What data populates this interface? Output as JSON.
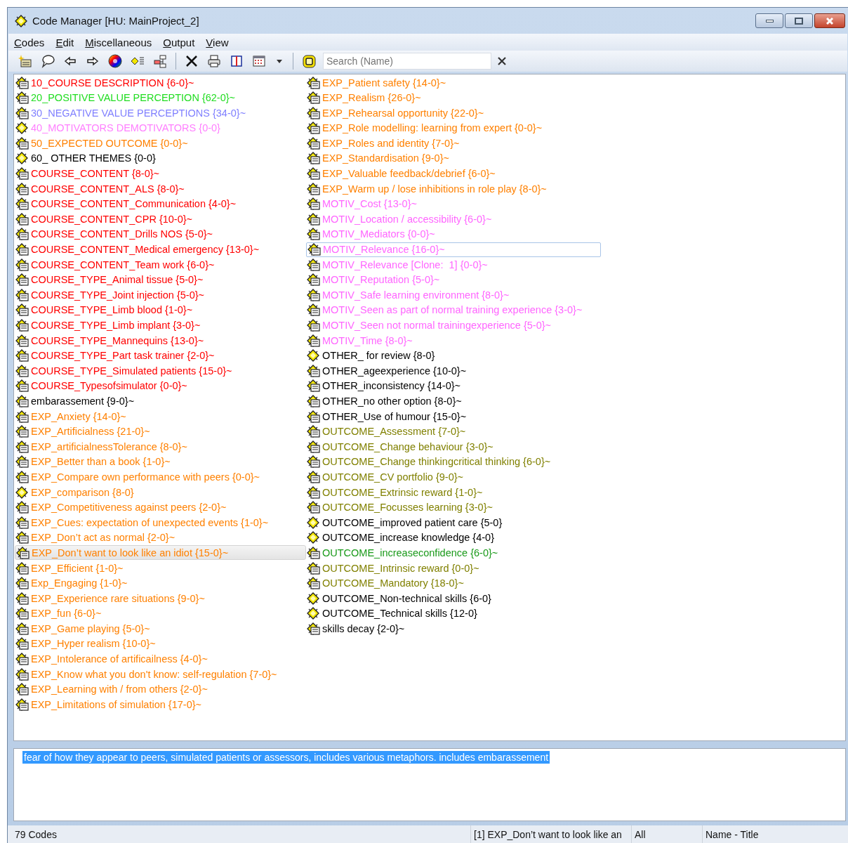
{
  "window": {
    "title": "Code Manager [HU: MainProject_2]"
  },
  "menu": [
    "Codes",
    "Edit",
    "Miscellaneous",
    "Output",
    "View"
  ],
  "search": {
    "placeholder": "Search (Name)"
  },
  "codes": [
    {
      "label": "10_COURSE DESCRIPTION {6-0}~",
      "color": "#ff0000",
      "kind": "commented",
      "selected": false,
      "focused": false
    },
    {
      "label": "20_POSITIVE VALUE PERCEPTION {62-0}~",
      "color": "#22dd22",
      "kind": "commented",
      "selected": false,
      "focused": false
    },
    {
      "label": "30_NEGATIVE VALUE PERCEPTIONS {34-0}~",
      "color": "#8080ff",
      "kind": "commented",
      "selected": false,
      "focused": false
    },
    {
      "label": "40_MOTIVATORS DEMOTIVATORS {0-0}",
      "color": "#ff80ff",
      "kind": "plain",
      "selected": false,
      "focused": false
    },
    {
      "label": "50_EXPECTED OUTCOME {0-0}~",
      "color": "#ff8000",
      "kind": "commented",
      "selected": false,
      "focused": false
    },
    {
      "label": "60_ OTHER THEMES {0-0}",
      "color": "#000000",
      "kind": "plain",
      "selected": false,
      "focused": false
    },
    {
      "label": "COURSE_CONTENT {8-0}~",
      "color": "#ff0000",
      "kind": "commented",
      "selected": false,
      "focused": false
    },
    {
      "label": "COURSE_CONTENT_ALS {8-0}~",
      "color": "#ff0000",
      "kind": "commented",
      "selected": false,
      "focused": false
    },
    {
      "label": "COURSE_CONTENT_Communication {4-0}~",
      "color": "#ff0000",
      "kind": "commented",
      "selected": false,
      "focused": false
    },
    {
      "label": "COURSE_CONTENT_CPR {10-0}~",
      "color": "#ff0000",
      "kind": "commented",
      "selected": false,
      "focused": false
    },
    {
      "label": "COURSE_CONTENT_Drills NOS {5-0}~",
      "color": "#ff0000",
      "kind": "commented",
      "selected": false,
      "focused": false
    },
    {
      "label": "COURSE_CONTENT_Medical emergency {13-0}~",
      "color": "#ff0000",
      "kind": "commented",
      "selected": false,
      "focused": false
    },
    {
      "label": "COURSE_CONTENT_Team work {6-0}~",
      "color": "#ff0000",
      "kind": "commented",
      "selected": false,
      "focused": false
    },
    {
      "label": "COURSE_TYPE_Animal tissue {5-0}~",
      "color": "#ff0000",
      "kind": "commented",
      "selected": false,
      "focused": false
    },
    {
      "label": "COURSE_TYPE_Joint injection {5-0}~",
      "color": "#ff0000",
      "kind": "commented",
      "selected": false,
      "focused": false
    },
    {
      "label": "COURSE_TYPE_Limb blood {1-0}~",
      "color": "#ff0000",
      "kind": "commented",
      "selected": false,
      "focused": false
    },
    {
      "label": "COURSE_TYPE_Limb implant {3-0}~",
      "color": "#ff0000",
      "kind": "commented",
      "selected": false,
      "focused": false
    },
    {
      "label": "COURSE_TYPE_Mannequins {13-0}~",
      "color": "#ff0000",
      "kind": "commented",
      "selected": false,
      "focused": false
    },
    {
      "label": "COURSE_TYPE_Part task trainer {2-0}~",
      "color": "#ff0000",
      "kind": "commented",
      "selected": false,
      "focused": false
    },
    {
      "label": "COURSE_TYPE_Simulated patients {15-0}~",
      "color": "#ff0000",
      "kind": "commented",
      "selected": false,
      "focused": false
    },
    {
      "label": "COURSE_Typesofsimulator {0-0}~",
      "color": "#ff0000",
      "kind": "commented",
      "selected": false,
      "focused": false
    },
    {
      "label": "embarassement {9-0}~",
      "color": "#000000",
      "kind": "commented",
      "selected": false,
      "focused": false
    },
    {
      "label": "EXP_Anxiety {14-0}~",
      "color": "#ff8000",
      "kind": "commented",
      "selected": false,
      "focused": false
    },
    {
      "label": "EXP_Artificialness {21-0}~",
      "color": "#ff8000",
      "kind": "commented",
      "selected": false,
      "focused": false
    },
    {
      "label": "EXP_artificialnessTolerance {8-0}~",
      "color": "#ff8000",
      "kind": "commented",
      "selected": false,
      "focused": false
    },
    {
      "label": "EXP_Better than a book {1-0}~",
      "color": "#ff8000",
      "kind": "commented",
      "selected": false,
      "focused": false
    },
    {
      "label": "EXP_Compare own performance with peers {0-0}~",
      "color": "#ff8000",
      "kind": "commented",
      "selected": false,
      "focused": false
    },
    {
      "label": "EXP_comparison {8-0}",
      "color": "#ff8000",
      "kind": "plain",
      "selected": false,
      "focused": false
    },
    {
      "label": "EXP_Competitiveness against peers {2-0}~",
      "color": "#ff8000",
      "kind": "commented",
      "selected": false,
      "focused": false
    },
    {
      "label": "EXP_Cues: expectation of unexpected events {1-0}~",
      "color": "#ff8000",
      "kind": "commented",
      "selected": false,
      "focused": false
    },
    {
      "label": "EXP_Don’t act as normal {2-0}~",
      "color": "#ff8000",
      "kind": "commented",
      "selected": false,
      "focused": false
    },
    {
      "label": "EXP_Don’t want to look like an idiot {15-0}~",
      "color": "#ff8000",
      "kind": "commented",
      "selected": true,
      "focused": false
    },
    {
      "label": "EXP_Efficient {1-0}~",
      "color": "#ff8000",
      "kind": "commented",
      "selected": false,
      "focused": false
    },
    {
      "label": "Exp_Engaging {1-0}~",
      "color": "#ff8000",
      "kind": "commented",
      "selected": false,
      "focused": false
    },
    {
      "label": "EXP_Experience rare situations {9-0}~",
      "color": "#ff8000",
      "kind": "commented",
      "selected": false,
      "focused": false
    },
    {
      "label": "EXP_fun {6-0}~",
      "color": "#ff8000",
      "kind": "commented",
      "selected": false,
      "focused": false
    },
    {
      "label": "EXP_Game playing {5-0}~",
      "color": "#ff8000",
      "kind": "commented",
      "selected": false,
      "focused": false
    },
    {
      "label": "EXP_Hyper realism {10-0}~",
      "color": "#ff8000",
      "kind": "commented",
      "selected": false,
      "focused": false
    },
    {
      "label": "EXP_Intolerance of artificailness {4-0}~",
      "color": "#ff8000",
      "kind": "commented",
      "selected": false,
      "focused": false
    },
    {
      "label": "EXP_Know what you don't know: self-regulation {7-0}~",
      "color": "#ff8000",
      "kind": "commented",
      "selected": false,
      "focused": false
    },
    {
      "label": "EXP_Learning with / from others {2-0}~",
      "color": "#ff8000",
      "kind": "commented",
      "selected": false,
      "focused": false
    },
    {
      "label": "EXP_Limitations of simulation {17-0}~",
      "color": "#ff8000",
      "kind": "commented",
      "selected": false,
      "focused": false
    },
    {
      "label": "EXP_Patient safety {14-0}~",
      "color": "#ff8000",
      "kind": "commented",
      "selected": false,
      "focused": false
    },
    {
      "label": "EXP_Realism {26-0}~",
      "color": "#ff8000",
      "kind": "commented",
      "selected": false,
      "focused": false
    },
    {
      "label": "EXP_Rehearsal opportunity {22-0}~",
      "color": "#ff8000",
      "kind": "commented",
      "selected": false,
      "focused": false
    },
    {
      "label": "EXP_Role modelling: learning from expert {0-0}~",
      "color": "#ff8000",
      "kind": "commented",
      "selected": false,
      "focused": false
    },
    {
      "label": "EXP_Roles and identity {7-0}~",
      "color": "#ff8000",
      "kind": "commented",
      "selected": false,
      "focused": false
    },
    {
      "label": "EXP_Standardisation {9-0}~",
      "color": "#ff8000",
      "kind": "commented",
      "selected": false,
      "focused": false
    },
    {
      "label": "EXP_Valuable feedback/debrief {6-0}~",
      "color": "#ff8000",
      "kind": "commented",
      "selected": false,
      "focused": false
    },
    {
      "label": "EXP_Warm up / lose inhibitions in role play {8-0}~",
      "color": "#ff8000",
      "kind": "commented",
      "selected": false,
      "focused": false
    },
    {
      "label": "MOTIV_Cost {13-0}~",
      "color": "#ff66ff",
      "kind": "commented",
      "selected": false,
      "focused": false
    },
    {
      "label": "MOTIV_Location / accessibility {6-0}~",
      "color": "#ff66ff",
      "kind": "commented",
      "selected": false,
      "focused": false
    },
    {
      "label": "MOTIV_Mediators {0-0}~",
      "color": "#ff66ff",
      "kind": "commented",
      "selected": false,
      "focused": false
    },
    {
      "label": "MOTIV_Relevance {16-0}~",
      "color": "#ff66ff",
      "kind": "commented",
      "selected": false,
      "focused": true
    },
    {
      "label": "MOTIV_Relevance [Clone:  1] {0-0}~",
      "color": "#ff66ff",
      "kind": "commented",
      "selected": false,
      "focused": false
    },
    {
      "label": "MOTIV_Reputation {5-0}~",
      "color": "#ff66ff",
      "kind": "commented",
      "selected": false,
      "focused": false
    },
    {
      "label": "MOTIV_Safe learning environment {8-0}~",
      "color": "#ff66ff",
      "kind": "commented",
      "selected": false,
      "focused": false
    },
    {
      "label": "MOTIV_Seen as part of normal training experience {3-0}~",
      "color": "#ff66ff",
      "kind": "commented",
      "selected": false,
      "focused": false
    },
    {
      "label": "MOTIV_Seen not normal trainingexperience {5-0}~",
      "color": "#ff66ff",
      "kind": "commented",
      "selected": false,
      "focused": false
    },
    {
      "label": "MOTIV_Time {8-0}~",
      "color": "#ff66ff",
      "kind": "commented",
      "selected": false,
      "focused": false
    },
    {
      "label": "OTHER_ for review {8-0}",
      "color": "#000000",
      "kind": "plain",
      "selected": false,
      "focused": false
    },
    {
      "label": "OTHER_ageexperience {10-0}~",
      "color": "#000000",
      "kind": "commented",
      "selected": false,
      "focused": false
    },
    {
      "label": "OTHER_inconsistency {14-0}~",
      "color": "#000000",
      "kind": "commented",
      "selected": false,
      "focused": false
    },
    {
      "label": "OTHER_no other option {8-0}~",
      "color": "#000000",
      "kind": "commented",
      "selected": false,
      "focused": false
    },
    {
      "label": "OTHER_Use of humour {15-0}~",
      "color": "#000000",
      "kind": "commented",
      "selected": false,
      "focused": false
    },
    {
      "label": "OUTCOME_Assessment {7-0}~",
      "color": "#808000",
      "kind": "commented",
      "selected": false,
      "focused": false
    },
    {
      "label": "OUTCOME_Change behaviour {3-0}~",
      "color": "#808000",
      "kind": "commented",
      "selected": false,
      "focused": false
    },
    {
      "label": "OUTCOME_Change thinkingcritical thinking {6-0}~",
      "color": "#808000",
      "kind": "commented",
      "selected": false,
      "focused": false
    },
    {
      "label": "OUTCOME_CV portfolio {9-0}~",
      "color": "#808000",
      "kind": "commented",
      "selected": false,
      "focused": false
    },
    {
      "label": "OUTCOME_Extrinsic reward {1-0}~",
      "color": "#808000",
      "kind": "commented",
      "selected": false,
      "focused": false
    },
    {
      "label": "OUTCOME_Focusses learning {3-0}~",
      "color": "#808000",
      "kind": "commented",
      "selected": false,
      "focused": false
    },
    {
      "label": "OUTCOME_improved patient care {5-0}",
      "color": "#000000",
      "kind": "plain",
      "selected": false,
      "focused": false
    },
    {
      "label": "OUTCOME_increase knowledge {4-0}",
      "color": "#000000",
      "kind": "plain",
      "selected": false,
      "focused": false
    },
    {
      "label": "OUTCOME_increaseconfidence {6-0}~",
      "color": "#1a9a1a",
      "kind": "commented",
      "selected": false,
      "focused": false
    },
    {
      "label": "OUTCOME_Intrinsic reward {0-0}~",
      "color": "#808000",
      "kind": "commented",
      "selected": false,
      "focused": false
    },
    {
      "label": "OUTCOME_Mandatory {18-0}~",
      "color": "#808000",
      "kind": "commented",
      "selected": false,
      "focused": false
    },
    {
      "label": "OUTCOME_Non-technical skills {6-0}",
      "color": "#000000",
      "kind": "plain",
      "selected": false,
      "focused": false
    },
    {
      "label": "OUTCOME_Technical skills {12-0}",
      "color": "#000000",
      "kind": "plain",
      "selected": false,
      "focused": false
    },
    {
      "label": "skills decay {2-0}~",
      "color": "#000000",
      "kind": "commented",
      "selected": false,
      "focused": false
    }
  ],
  "comment": {
    "text": "fear of how they appear to peers, simulated patients or assessors, includes various metaphors. includes embarassement",
    "selected": true
  },
  "status_bar": [
    "79 Codes",
    "[1] EXP_Don’t want to look like an",
    "All",
    "Name - Title"
  ]
}
